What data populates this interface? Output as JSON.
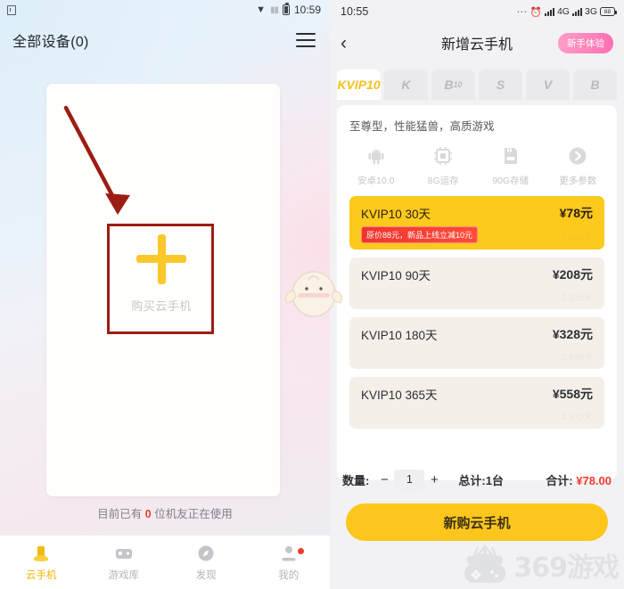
{
  "left": {
    "statusbar": {
      "time": "10:59",
      "icons": [
        "app-icon",
        "wifi-icon",
        "signal-icon",
        "battery-icon"
      ]
    },
    "appbar": {
      "title": "全部设备(0)",
      "menu_icon": "hamburger-icon"
    },
    "add_device": {
      "plus_icon": "plus-icon",
      "label": "购买云手机"
    },
    "usage_note": {
      "prefix": "目前已有 ",
      "count": "0",
      "suffix": " 位机友正在使用"
    },
    "tabbar": [
      {
        "label": "云手机",
        "icon": "cloud-phone-icon",
        "active": true,
        "badge": false
      },
      {
        "label": "游戏库",
        "icon": "game-library-icon",
        "active": false,
        "badge": false
      },
      {
        "label": "发现",
        "icon": "discover-icon",
        "active": false,
        "badge": false
      },
      {
        "label": "我的",
        "icon": "profile-icon",
        "active": false,
        "badge": true
      }
    ],
    "annotation": {
      "shape": "red-rectangle",
      "arrow": "red-arrow",
      "color": "#9c1d13"
    }
  },
  "right": {
    "statusbar": {
      "time": "10:55",
      "net1": "4G",
      "net2": "3G",
      "battery": "88",
      "icons": [
        "dots-icon",
        "alarm-icon",
        "signal-icon",
        "battery-icon"
      ]
    },
    "appbar": {
      "back_icon": "back-chevron-icon",
      "title": "新增云手机",
      "badge": "新手体验"
    },
    "tabs": [
      {
        "label": "KVIP10",
        "active": true
      },
      {
        "label": "K",
        "active": false
      },
      {
        "label": "B",
        "sub": "10",
        "active": false
      },
      {
        "label": "S",
        "active": false
      },
      {
        "label": "V",
        "active": false
      },
      {
        "label": "B",
        "active": false
      }
    ],
    "plan_headline": "至尊型，性能猛兽，高质游戏",
    "specs": [
      {
        "icon": "android-icon",
        "label": "安卓10.0"
      },
      {
        "icon": "chip-icon",
        "label": "8G运存"
      },
      {
        "icon": "storage-icon",
        "label": "90G存储"
      },
      {
        "icon": "arrow-right-circle-icon",
        "label": "更多参数"
      }
    ],
    "plans": [
      {
        "name": "KVIP10 30天",
        "price": "¥78元",
        "per_day": "2.6元/天",
        "promo": "原价88元，新品上线立减10元",
        "selected": true
      },
      {
        "name": "KVIP10 90天",
        "price": "¥208元",
        "per_day": "2.3元/天",
        "promo": "",
        "selected": false
      },
      {
        "name": "KVIP10 180天",
        "price": "¥328元",
        "per_day": "1.8元/天",
        "promo": "",
        "selected": false
      },
      {
        "name": "KVIP10 365天",
        "price": "¥558元",
        "per_day": "1.5元/天",
        "promo": "",
        "selected": false
      }
    ],
    "quantity": {
      "label": "数量:",
      "minus": "−",
      "value": "1",
      "plus": "+",
      "total_units_label": "总计:",
      "total_units": "1台",
      "grand_label": "合计:",
      "grand_total": "¥78.00"
    },
    "buy_button": "新购云手机",
    "watermark": {
      "text": "369游戏",
      "logo": "pineapple-gamepad-logo"
    }
  },
  "colors": {
    "accent_yellow": "#fcc61c",
    "promo_red": "#f0342c",
    "badge_pink": "#ff6fb1",
    "annotation_red": "#9c1d13",
    "selected_card": "#fcc91d",
    "plan_card": "#f4efe9"
  }
}
